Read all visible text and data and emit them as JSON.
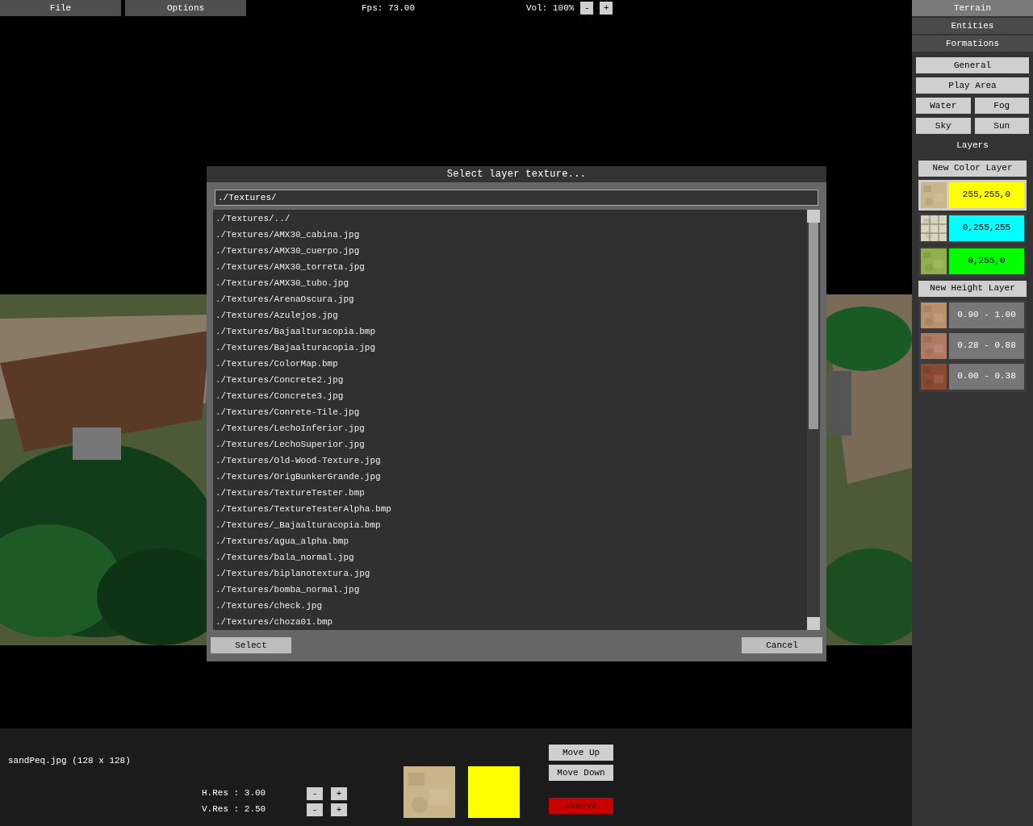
{
  "menu": [
    {
      "label": "File"
    },
    {
      "label": "Options"
    }
  ],
  "fps": "Fps: 73.00",
  "volume": {
    "label": "Vol: 100%",
    "buttons": [
      "-",
      "+"
    ]
  },
  "side_tabs": [
    {
      "label": "Terrain",
      "selected": true
    },
    {
      "label": "Entities",
      "selected": false
    },
    {
      "label": "Formations",
      "selected": false
    }
  ],
  "terrain_buttons": [
    {
      "label": "General",
      "kind": "wide"
    },
    {
      "label": "Play Area",
      "kind": "wide"
    },
    {
      "label": "Water",
      "kind": "half"
    },
    {
      "label": "Fog",
      "kind": "half"
    },
    {
      "label": "Sky",
      "kind": "half"
    },
    {
      "label": "Sun",
      "kind": "half"
    }
  ],
  "layers_heading": "Layers",
  "new_color_layer": "New Color Layer",
  "color_layers": [
    {
      "value": "255,255,0",
      "color": "#ffff00",
      "selected": true
    },
    {
      "value": "0,255,255",
      "color": "#00ffff",
      "selected": false
    },
    {
      "value": "0,255,0",
      "color": "#00ff00",
      "selected": false
    }
  ],
  "new_height_layer": "New Height Layer",
  "height_layers": [
    {
      "value": "0.90 - 1.00",
      "selected": false
    },
    {
      "value": "0.28 - 0.88",
      "selected": false
    },
    {
      "value": "0.00 - 0.38",
      "selected": false
    }
  ],
  "dialog": {
    "title": "Select layer texture...",
    "path": "./Textures/",
    "files": [
      "./Textures/../",
      "./Textures/AMX30_cabina.jpg",
      "./Textures/AMX30_cuerpo.jpg",
      "./Textures/AMX30_torreta.jpg",
      "./Textures/AMX30_tubo.jpg",
      "./Textures/ArenaOscura.jpg",
      "./Textures/Azulejos.jpg",
      "./Textures/Bajaalturacopia.bmp",
      "./Textures/Bajaalturacopia.jpg",
      "./Textures/ColorMap.bmp",
      "./Textures/Concrete2.jpg",
      "./Textures/Concrete3.jpg",
      "./Textures/Conrete-Tile.jpg",
      "./Textures/LechoInferior.jpg",
      "./Textures/LechoSuperior.jpg",
      "./Textures/Old-Wood-Texture.jpg",
      "./Textures/OrigBunkerGrande.jpg",
      "./Textures/TextureTester.bmp",
      "./Textures/TextureTesterAlpha.bmp",
      "./Textures/_Bajaalturacopia.bmp",
      "./Textures/agua_alpha.bmp",
      "./Textures/bala_normal.jpg",
      "./Textures/biplanotextura.jpg",
      "./Textures/bomba_normal.jpg",
      "./Textures/check.jpg",
      "./Textures/choza01.bmp"
    ],
    "buttons": [
      {
        "label": "Select"
      },
      {
        "label": "Cancel"
      }
    ]
  },
  "bottom": {
    "file_info": "sandPeq.jpg (128 x 128)",
    "resolutions": [
      {
        "label": "H.Res : 3.00",
        "buttons": [
          "-",
          "+"
        ]
      },
      {
        "label": "V.Res : 2.50",
        "buttons": [
          "-",
          "+"
        ]
      }
    ],
    "selected_layer": {
      "color": "#ffff00"
    },
    "buttons": [
      {
        "label": "Move Up",
        "kind": "normal"
      },
      {
        "label": "Move Down",
        "kind": "normal"
      },
      {
        "label": "Remove",
        "kind": "danger"
      }
    ]
  }
}
